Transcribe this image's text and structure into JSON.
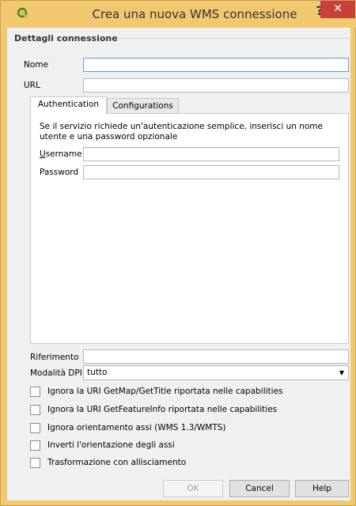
{
  "window": {
    "title": "Crea una nuova WMS connessione",
    "help_glyph": "?",
    "close_glyph": "✕",
    "accent_color": "#f1c86f",
    "close_color": "#c7403a"
  },
  "group": {
    "legend": "Dettagli connessione"
  },
  "fields": {
    "name_label": "Nome",
    "name_value": "",
    "url_label": "URL",
    "url_value": ""
  },
  "tabs": [
    {
      "label": "Authentication",
      "active": true
    },
    {
      "label": "Configurations",
      "active": false
    }
  ],
  "auth": {
    "description": "Se il servizio richiede un'autenticazione semplice, inserisci un nome utente e una password opzionale",
    "username_label_prefix": "U",
    "username_label_rest": "sername",
    "username_value": "",
    "password_label": "Password",
    "password_value": ""
  },
  "reference": {
    "label": "Riferimento",
    "value": ""
  },
  "dpi": {
    "label": "Modalità DPI",
    "selected": "tutto"
  },
  "checkboxes": [
    {
      "label": "Ignora la URI GetMap/GetTitle riportata nelle capabilities",
      "checked": false
    },
    {
      "label": "Ignora la URI GetFeatureInfo riportata nelle capabilities",
      "checked": false
    },
    {
      "label": "Ignora orientamento assi (WMS 1.3/WMTS)",
      "checked": false
    },
    {
      "label": "Inverti l'orientazione degli assi",
      "checked": false
    },
    {
      "label": "Trasformazione con allisciamento",
      "checked": false
    }
  ],
  "buttons": {
    "ok": "OK",
    "cancel": "Cancel",
    "help": "Help"
  }
}
